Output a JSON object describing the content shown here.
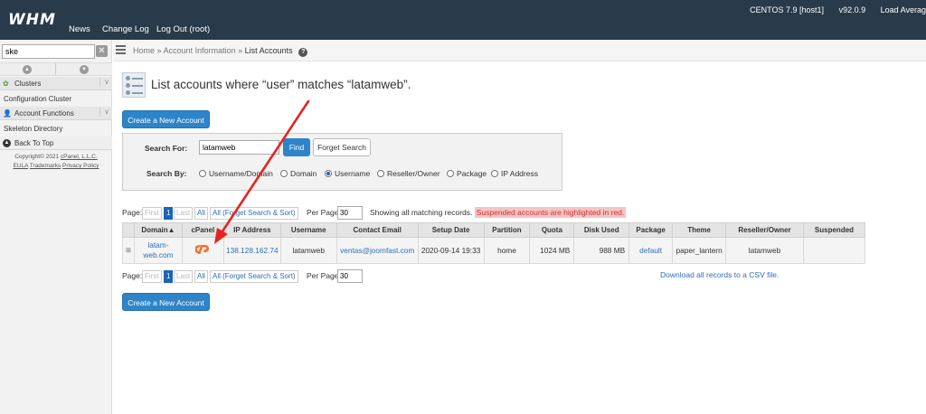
{
  "topbar": {
    "logo": "WHM",
    "nav": [
      "News",
      "Change Log",
      "Log Out (root)"
    ],
    "os": "CENTOS 7.9 [host1]",
    "version": "v92.0.9",
    "load": "Load Averag"
  },
  "sidebar": {
    "search_value": "ske",
    "clear_label": "✕",
    "categories": [
      {
        "label": "Clusters",
        "items": [
          "Configuration Cluster"
        ]
      },
      {
        "label": "Account Functions",
        "items": [
          "Skeleton Directory"
        ]
      }
    ],
    "back_to_top": "Back To Top",
    "footer": {
      "copyright": "Copyright© 2021",
      "company": "cPanel, L.L.C.",
      "links": [
        "EULA",
        "Trademarks",
        "Privacy Policy"
      ]
    }
  },
  "breadcrumb": {
    "home": "Home",
    "section": "Account Information",
    "current": "List Accounts",
    "separator": "»"
  },
  "page": {
    "title": "List accounts where “user” matches “latamweb”."
  },
  "buttons": {
    "create_account": "Create a New Account"
  },
  "search": {
    "search_for_label": "Search For:",
    "search_value": "latamweb",
    "find_label": "Find",
    "forget_label": "Forget Search",
    "search_by_label": "Search By:",
    "options": [
      "Username/Domain",
      "Domain",
      "Username",
      "Reseller/Owner",
      "Package",
      "IP Address"
    ],
    "selected": "Username"
  },
  "pagination": {
    "page_label": "Page:",
    "first": "First",
    "current_page": "1",
    "last": "Last",
    "all": "All",
    "all_forget": "All (Forget Search & Sort)",
    "per_page_label": "Per Page:",
    "per_page_value": "30"
  },
  "status": {
    "showing": "Showing all matching records.",
    "suspended_note": "Suspended accounts are highlighted in red."
  },
  "table": {
    "columns": [
      "Domain▲",
      "cPanel",
      "IP Address",
      "Username",
      "Contact Email",
      "Setup Date",
      "Partition",
      "Quota",
      "Disk Used",
      "Package",
      "Theme",
      "Reseller/Owner",
      "Suspended"
    ],
    "rows": [
      {
        "expand": "⊞",
        "domain": "latam-web.com",
        "ip": "138.128.162.74",
        "username": "latamweb",
        "email": "ventas@joomfast.com",
        "setup_date": "2020-09-14 19:33",
        "partition": "home",
        "quota": "1024 MB",
        "disk_used": "988 MB",
        "package": "default",
        "theme": "paper_lantern",
        "owner": "latamweb",
        "suspended": ""
      }
    ]
  },
  "csv": {
    "label": "Download all records to a CSV file."
  },
  "colors": {
    "topbar": "#293a4a",
    "button_blue": "#2e84c8",
    "link": "#2e6fb7",
    "suspended_highlight": "#f5c4c4",
    "arrow": "#e8231f",
    "cpanel_orange": "#ff6c2c"
  }
}
